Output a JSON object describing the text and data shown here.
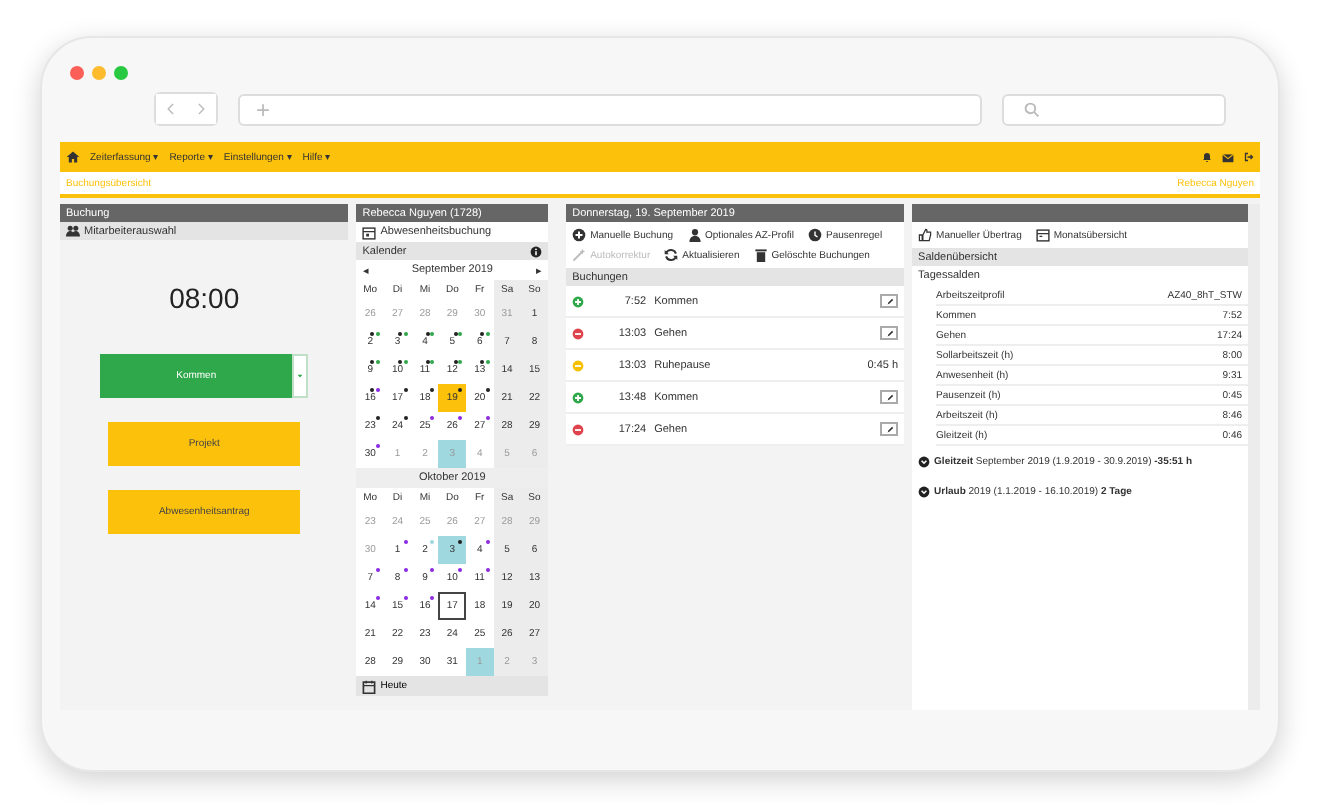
{
  "browser": {
    "address_icon": "+"
  },
  "menu": {
    "items": [
      {
        "label": "Zeiterfassung ▾"
      },
      {
        "label": "Reporte ▾"
      },
      {
        "label": "Einstellungen ▾"
      },
      {
        "label": "Hilfe ▾"
      }
    ]
  },
  "breadcrumb": {
    "page": "Buchungsübersicht",
    "user": "Rebecca Nguyen"
  },
  "booking": {
    "title": "Buchung",
    "employee_select": "Mitarbeiterauswahl",
    "time": "08:00",
    "buttons": [
      {
        "label": "Kommen",
        "kind": "success",
        "dropdown": true
      },
      {
        "label": "Projekt",
        "kind": "warning",
        "dropdown": false
      },
      {
        "label": "Abwesenheitsantrag",
        "kind": "warning",
        "dropdown": false
      }
    ]
  },
  "calendar_panel": {
    "title": "Rebecca Nguyen (1728)",
    "absence_booking": "Abwesenheitsbuchung",
    "calendar_title": "Kalender",
    "today_button": "Heute",
    "months": [
      {
        "prev": "◂",
        "title": "September 2019",
        "next": "▸",
        "weekdays": [
          "Mo",
          "Di",
          "Mi",
          "Do",
          "Fr",
          "Sa",
          "So"
        ],
        "weeks": [
          [
            {
              "day": "26",
              "muted": true,
              "selected": false,
              "today": false,
              "marked": false
            },
            {
              "day": "27",
              "muted": true,
              "selected": false,
              "today": false,
              "marked": false
            },
            {
              "day": "28",
              "muted": true,
              "selected": false,
              "today": false,
              "marked": false
            },
            {
              "day": "29",
              "muted": true,
              "selected": false,
              "today": false,
              "marked": false
            },
            {
              "day": "30",
              "muted": true,
              "selected": false,
              "today": false,
              "marked": false
            },
            {
              "day": "31",
              "muted": true,
              "selected": false,
              "today": false,
              "marked": false
            },
            {
              "day": "1",
              "muted": false,
              "selected": false,
              "today": false,
              "marked": false
            }
          ],
          [
            {
              "day": "2",
              "muted": false,
              "selected": false,
              "today": false,
              "marked": false,
              "dots": [
                {
                  "color": "#222222"
                },
                {
                  "color": "#2ea84a"
                }
              ]
            },
            {
              "day": "3",
              "muted": false,
              "selected": false,
              "today": false,
              "marked": false,
              "dots": [
                {
                  "color": "#222222"
                },
                {
                  "color": "#2ea84a"
                }
              ]
            },
            {
              "day": "4",
              "muted": false,
              "selected": false,
              "today": false,
              "marked": false,
              "dots": [
                {
                  "color": "#222222"
                },
                {
                  "color": "#2ea84a"
                }
              ]
            },
            {
              "day": "5",
              "muted": false,
              "selected": false,
              "today": false,
              "marked": false,
              "dots": [
                {
                  "color": "#222222"
                },
                {
                  "color": "#2ea84a"
                }
              ]
            },
            {
              "day": "6",
              "muted": false,
              "selected": false,
              "today": false,
              "marked": false,
              "dots": [
                {
                  "color": "#222222"
                },
                {
                  "color": "#2ea84a"
                }
              ]
            },
            {
              "day": "7",
              "muted": false,
              "selected": false,
              "today": false,
              "marked": false
            },
            {
              "day": "8",
              "muted": false,
              "selected": false,
              "today": false,
              "marked": false
            }
          ],
          [
            {
              "day": "9",
              "muted": false,
              "selected": false,
              "today": false,
              "marked": false,
              "dots": [
                {
                  "color": "#222222"
                },
                {
                  "color": "#2ea84a"
                }
              ]
            },
            {
              "day": "10",
              "muted": false,
              "selected": false,
              "today": false,
              "marked": false,
              "dots": [
                {
                  "color": "#222222"
                },
                {
                  "color": "#2ea84a"
                }
              ]
            },
            {
              "day": "11",
              "muted": false,
              "selected": false,
              "today": false,
              "marked": false,
              "dots": [
                {
                  "color": "#222222"
                },
                {
                  "color": "#2ea84a"
                }
              ]
            },
            {
              "day": "12",
              "muted": false,
              "selected": false,
              "today": false,
              "marked": false,
              "dots": [
                {
                  "color": "#222222"
                },
                {
                  "color": "#2ea84a"
                }
              ]
            },
            {
              "day": "13",
              "muted": false,
              "selected": false,
              "today": false,
              "marked": false,
              "dots": [
                {
                  "color": "#222222"
                },
                {
                  "color": "#2ea84a"
                }
              ]
            },
            {
              "day": "14",
              "muted": false,
              "selected": false,
              "today": false,
              "marked": false
            },
            {
              "day": "15",
              "muted": false,
              "selected": false,
              "today": false,
              "marked": false
            }
          ],
          [
            {
              "day": "16",
              "muted": false,
              "selected": false,
              "today": false,
              "marked": false,
              "dots": [
                {
                  "color": "#222222"
                },
                {
                  "color": "#8a2be2"
                }
              ]
            },
            {
              "day": "17",
              "muted": false,
              "selected": false,
              "today": false,
              "marked": false,
              "dots": [
                {
                  "color": "#222222"
                }
              ]
            },
            {
              "day": "18",
              "muted": false,
              "selected": false,
              "today": false,
              "marked": false,
              "dots": [
                {
                  "color": "#222222"
                }
              ]
            },
            {
              "day": "19",
              "muted": false,
              "selected": true,
              "today": false,
              "marked": false,
              "dots": [
                {
                  "color": "#222222"
                }
              ]
            },
            {
              "day": "20",
              "muted": false,
              "selected": false,
              "today": false,
              "marked": false,
              "dots": [
                {
                  "color": "#222222"
                }
              ]
            },
            {
              "day": "21",
              "muted": false,
              "selected": false,
              "today": false,
              "marked": false
            },
            {
              "day": "22",
              "muted": false,
              "selected": false,
              "today": false,
              "marked": false
            }
          ],
          [
            {
              "day": "23",
              "muted": false,
              "selected": false,
              "today": false,
              "marked": false,
              "dots": [
                {
                  "color": "#222222"
                }
              ]
            },
            {
              "day": "24",
              "muted": false,
              "selected": false,
              "today": false,
              "marked": false,
              "dots": [
                {
                  "color": "#222222"
                }
              ]
            },
            {
              "day": "25",
              "muted": false,
              "selected": false,
              "today": false,
              "marked": false,
              "dots": [
                {
                  "color": "#8a2be2"
                }
              ]
            },
            {
              "day": "26",
              "muted": false,
              "selected": false,
              "today": false,
              "marked": false,
              "dots": [
                {
                  "color": "#8a2be2"
                }
              ]
            },
            {
              "day": "27",
              "muted": false,
              "selected": false,
              "today": false,
              "marked": false,
              "dots": [
                {
                  "color": "#8a2be2"
                }
              ]
            },
            {
              "day": "28",
              "muted": false,
              "selected": false,
              "today": false,
              "marked": false
            },
            {
              "day": "29",
              "muted": false,
              "selected": false,
              "today": false,
              "marked": false
            }
          ],
          [
            {
              "day": "30",
              "muted": false,
              "selected": false,
              "today": false,
              "marked": false,
              "dots": [
                {
                  "color": "#8a2be2"
                }
              ]
            },
            {
              "day": "1",
              "muted": true,
              "selected": false,
              "today": false,
              "marked": false
            },
            {
              "day": "2",
              "muted": true,
              "selected": false,
              "today": false,
              "marked": false
            },
            {
              "day": "3",
              "muted": true,
              "selected": false,
              "today": false,
              "marked": true
            },
            {
              "day": "4",
              "muted": true,
              "selected": false,
              "today": false,
              "marked": false
            },
            {
              "day": "5",
              "muted": true,
              "selected": false,
              "today": false,
              "marked": false
            },
            {
              "day": "6",
              "muted": true,
              "selected": false,
              "today": false,
              "marked": false
            }
          ]
        ]
      },
      {
        "title": "Oktober 2019",
        "weekdays": [
          "Mo",
          "Di",
          "Mi",
          "Do",
          "Fr",
          "Sa",
          "So"
        ],
        "weeks": [
          [
            {
              "day": "23",
              "muted": true,
              "selected": false,
              "today": false,
              "marked": false
            },
            {
              "day": "24",
              "muted": true,
              "selected": false,
              "today": false,
              "marked": false
            },
            {
              "day": "25",
              "muted": true,
              "selected": false,
              "today": false,
              "marked": false
            },
            {
              "day": "26",
              "muted": true,
              "selected": false,
              "today": false,
              "marked": false
            },
            {
              "day": "27",
              "muted": true,
              "selected": false,
              "today": false,
              "marked": false
            },
            {
              "day": "28",
              "muted": true,
              "selected": false,
              "today": false,
              "marked": false
            },
            {
              "day": "29",
              "muted": true,
              "selected": false,
              "today": false,
              "marked": false
            }
          ],
          [
            {
              "day": "30",
              "muted": true,
              "selected": false,
              "today": false,
              "marked": false
            },
            {
              "day": "1",
              "muted": false,
              "selected": false,
              "today": false,
              "marked": false,
              "dots": [
                {
                  "color": "#8a2be2"
                }
              ]
            },
            {
              "day": "2",
              "muted": false,
              "selected": false,
              "today": false,
              "marked": false,
              "dots": [
                {
                  "color": "#9fd8df"
                }
              ]
            },
            {
              "day": "3",
              "muted": false,
              "selected": false,
              "today": false,
              "marked": true,
              "dots": [
                {
                  "color": "#222222"
                }
              ]
            },
            {
              "day": "4",
              "muted": false,
              "selected": false,
              "today": false,
              "marked": false,
              "dots": [
                {
                  "color": "#8a2be2"
                }
              ]
            },
            {
              "day": "5",
              "muted": false,
              "selected": false,
              "today": false,
              "marked": false
            },
            {
              "day": "6",
              "muted": false,
              "selected": false,
              "today": false,
              "marked": false
            }
          ],
          [
            {
              "day": "7",
              "muted": false,
              "selected": false,
              "today": false,
              "marked": false,
              "dots": [
                {
                  "color": "#8a2be2"
                }
              ]
            },
            {
              "day": "8",
              "muted": false,
              "selected": false,
              "today": false,
              "marked": false,
              "dots": [
                {
                  "color": "#8a2be2"
                }
              ]
            },
            {
              "day": "9",
              "muted": false,
              "selected": false,
              "today": false,
              "marked": false,
              "dots": [
                {
                  "color": "#8a2be2"
                }
              ]
            },
            {
              "day": "10",
              "muted": false,
              "selected": false,
              "today": false,
              "marked": false,
              "dots": [
                {
                  "color": "#8a2be2"
                }
              ]
            },
            {
              "day": "11",
              "muted": false,
              "selected": false,
              "today": false,
              "marked": false,
              "dots": [
                {
                  "color": "#8a2be2"
                }
              ]
            },
            {
              "day": "12",
              "muted": false,
              "selected": false,
              "today": false,
              "marked": false
            },
            {
              "day": "13",
              "muted": false,
              "selected": false,
              "today": false,
              "marked": false
            }
          ],
          [
            {
              "day": "14",
              "muted": false,
              "selected": false,
              "today": false,
              "marked": false,
              "dots": [
                {
                  "color": "#8a2be2"
                }
              ]
            },
            {
              "day": "15",
              "muted": false,
              "selected": false,
              "today": false,
              "marked": false,
              "dots": [
                {
                  "color": "#8a2be2"
                }
              ]
            },
            {
              "day": "16",
              "muted": false,
              "selected": false,
              "today": false,
              "marked": false,
              "dots": [
                {
                  "color": "#8a2be2"
                }
              ]
            },
            {
              "day": "17",
              "muted": false,
              "selected": false,
              "today": true,
              "marked": false
            },
            {
              "day": "18",
              "muted": false,
              "selected": false,
              "today": false,
              "marked": false
            },
            {
              "day": "19",
              "muted": false,
              "selected": false,
              "today": false,
              "marked": false
            },
            {
              "day": "20",
              "muted": false,
              "selected": false,
              "today": false,
              "marked": false
            }
          ],
          [
            {
              "day": "21",
              "muted": false,
              "selected": false,
              "today": false,
              "marked": false
            },
            {
              "day": "22",
              "muted": false,
              "selected": false,
              "today": false,
              "marked": false
            },
            {
              "day": "23",
              "muted": false,
              "selected": false,
              "today": false,
              "marked": false
            },
            {
              "day": "24",
              "muted": false,
              "selected": false,
              "today": false,
              "marked": false
            },
            {
              "day": "25",
              "muted": false,
              "selected": false,
              "today": false,
              "marked": false
            },
            {
              "day": "26",
              "muted": false,
              "selected": false,
              "today": false,
              "marked": false
            },
            {
              "day": "27",
              "muted": false,
              "selected": false,
              "today": false,
              "marked": false
            }
          ],
          [
            {
              "day": "28",
              "muted": false,
              "selected": false,
              "today": false,
              "marked": false
            },
            {
              "day": "29",
              "muted": false,
              "selected": false,
              "today": false,
              "marked": false
            },
            {
              "day": "30",
              "muted": false,
              "selected": false,
              "today": false,
              "marked": false
            },
            {
              "day": "31",
              "muted": false,
              "selected": false,
              "today": false,
              "marked": false
            },
            {
              "day": "1",
              "muted": true,
              "selected": false,
              "today": false,
              "marked": true
            },
            {
              "day": "2",
              "muted": true,
              "selected": false,
              "today": false,
              "marked": false
            },
            {
              "day": "3",
              "muted": true,
              "selected": false,
              "today": false,
              "marked": false
            }
          ]
        ]
      }
    ]
  },
  "day_panel": {
    "title": "Donnerstag, 19. September 2019",
    "toolbar": [
      {
        "label": "Manuelle Buchung",
        "kind": "add",
        "disabled": false
      },
      {
        "label": "Optionales AZ-Profil",
        "kind": "user",
        "disabled": false
      },
      {
        "label": "Pausenregel",
        "kind": "clock",
        "disabled": false
      },
      {
        "label": "Autokorrektur",
        "kind": "wand",
        "disabled": true
      },
      {
        "label": "Aktualisieren",
        "kind": "refresh",
        "disabled": false
      },
      {
        "label": "Gelöschte Buchungen",
        "kind": "trash",
        "disabled": false
      }
    ],
    "section": "Buchungen",
    "bookings": [
      {
        "kind": "in",
        "time": "7:52",
        "label": "Kommen",
        "editable": true
      },
      {
        "kind": "out",
        "time": "13:03",
        "label": "Gehen",
        "editable": true
      },
      {
        "kind": "pause",
        "time": "13:03",
        "label": "Ruhepause",
        "duration": "0:45 h",
        "editable": false
      },
      {
        "kind": "in",
        "time": "13:48",
        "label": "Kommen",
        "editable": true
      },
      {
        "kind": "out",
        "time": "17:24",
        "label": "Gehen",
        "editable": true
      }
    ]
  },
  "balance_panel": {
    "toolbar": [
      {
        "label": "Manueller Übertrag",
        "kind": "hand"
      },
      {
        "label": "Monatsübersicht",
        "kind": "calendar"
      }
    ],
    "section": "Saldenübersicht",
    "subtitle": "Tagessalden",
    "rows": [
      {
        "label": "Arbeitszeitprofil",
        "value": "AZ40_8hT_STW"
      },
      {
        "label": "Kommen",
        "value": "7:52"
      },
      {
        "label": "Gehen",
        "value": "17:24"
      },
      {
        "label": "Sollarbeitszeit (h)",
        "value": "8:00"
      },
      {
        "label": "Anwesenheit (h)",
        "value": "9:31"
      },
      {
        "label": "Pausenzeit (h)",
        "value": "0:45"
      },
      {
        "label": "Arbeitszeit (h)",
        "value": "8:46"
      },
      {
        "label": "Gleitzeit (h)",
        "value": "0:46"
      }
    ],
    "summaries": [
      {
        "text": "**Gleitzeit** September 2019 (1.9.2019 - 30.9.2019) **-35:51 h**"
      },
      {
        "text": "**Urlaub** 2019 (1.1.2019 - 16.10.2019) **2 Tage**"
      }
    ]
  }
}
